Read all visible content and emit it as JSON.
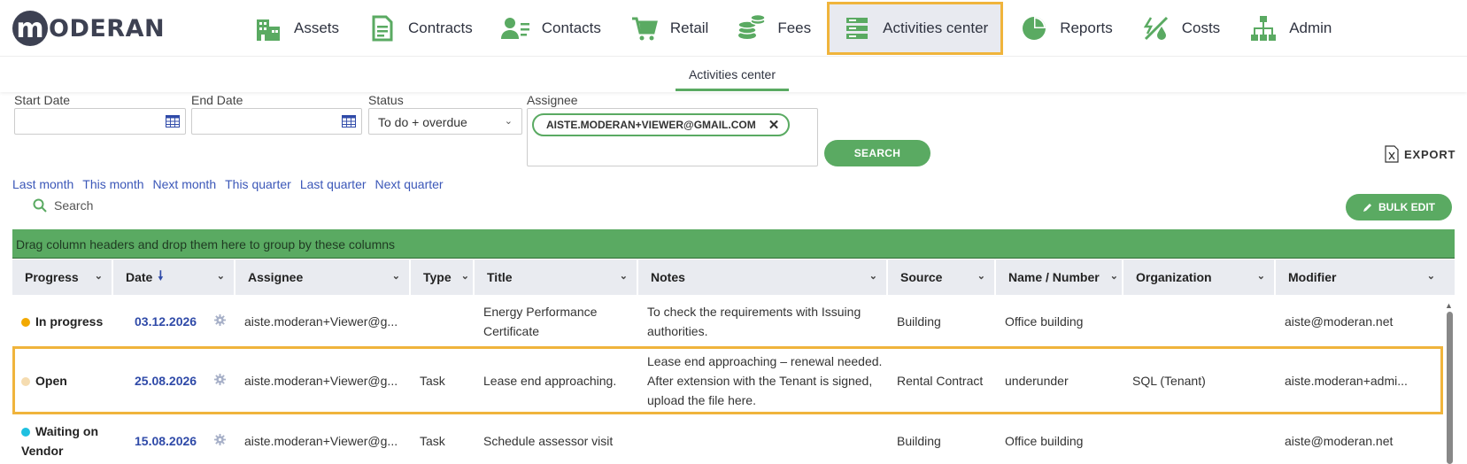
{
  "brand": {
    "logo_letter": "m",
    "logo_text": "ODERAN"
  },
  "nav": [
    {
      "label": "Assets",
      "icon": "building-icon"
    },
    {
      "label": "Contracts",
      "icon": "document-icon"
    },
    {
      "label": "Contacts",
      "icon": "contacts-icon"
    },
    {
      "label": "Retail",
      "icon": "cart-icon"
    },
    {
      "label": "Fees",
      "icon": "coins-icon"
    },
    {
      "label": "Activities center",
      "icon": "server-icon",
      "active": true
    },
    {
      "label": "Reports",
      "icon": "pie-chart-icon"
    },
    {
      "label": "Costs",
      "icon": "costs-icon"
    },
    {
      "label": "Admin",
      "icon": "org-chart-icon"
    }
  ],
  "subnav": {
    "tab": "Activities center"
  },
  "filters": {
    "start_date_label": "Start Date",
    "end_date_label": "End Date",
    "status_label": "Status",
    "status_value": "To do + overdue",
    "assignee_label": "Assignee",
    "assignee_chip": "AISTE.MODERAN+VIEWER@GMAIL.COM",
    "search_button": "SEARCH",
    "export_label": "EXPORT"
  },
  "quick_ranges": [
    "Last month",
    "This month",
    "Next month",
    "This quarter",
    "Last quarter",
    "Next quarter"
  ],
  "search": {
    "placeholder": "Search"
  },
  "bulk_edit": "BULK EDIT",
  "grid": {
    "group_hint": "Drag column headers and drop them here to group by these columns",
    "columns": [
      "Progress",
      "Date",
      "Assignee",
      "Type",
      "Title",
      "Notes",
      "Source",
      "Name / Number",
      "Organization",
      "Modifier"
    ],
    "rows": [
      {
        "progress": "In progress",
        "progress_color": "#f2a900",
        "date": "03.12.2026",
        "assignee": "aiste.moderan+Viewer@g...",
        "type": "",
        "title": "Energy Performance Certificate",
        "notes": "To check the requirements with Issuing authorities.",
        "source": "Building",
        "name": "Office building",
        "organization": "",
        "modifier": "aiste@moderan.net"
      },
      {
        "progress": "Open",
        "progress_color": "#f5dcb0",
        "date": "25.08.2026",
        "assignee": "aiste.moderan+Viewer@g...",
        "type": "Task",
        "title": "Lease end approaching.",
        "notes": "Lease end approaching – renewal needed. After extension with the Tenant is signed, upload the file here.",
        "source": "Rental Contract",
        "name": "underunder",
        "organization": "SQL (Tenant)",
        "modifier": "aiste.moderan+admi..."
      },
      {
        "progress": "Waiting on Vendor",
        "progress_color": "#1fc0e0",
        "date": "15.08.2026",
        "assignee": "aiste.moderan+Viewer@g...",
        "type": "Task",
        "title": "Schedule assessor visit",
        "notes": "",
        "source": "Building",
        "name": "Office building",
        "organization": "",
        "modifier": "aiste@moderan.net"
      }
    ]
  },
  "colors": {
    "accent": "#5aaa62",
    "highlight": "#f0b43c",
    "link": "#3b57b8",
    "nav_text": "#2f3340"
  }
}
